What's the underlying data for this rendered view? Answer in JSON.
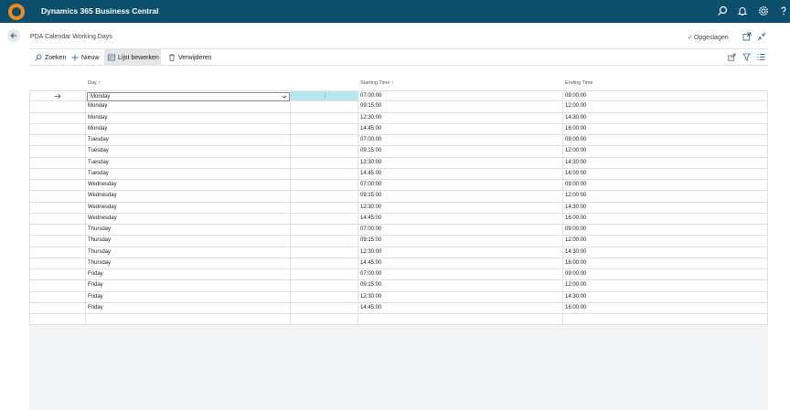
{
  "app": {
    "title": "Dynamics 365 Business Central",
    "icons": [
      "search-icon",
      "bell-icon",
      "gear-icon",
      "help-icon"
    ]
  },
  "page": {
    "title": "PDA Calendar Working Days",
    "saved_label": "Opgeslagen"
  },
  "actions": {
    "search": "Zoeken",
    "new": "Nieuw",
    "edit_list": "Lijst bewerken",
    "delete": "Verwijderen"
  },
  "grid": {
    "columns": {
      "day": "Day",
      "starting_time": "Starting Time",
      "ending_time": "Ending Time"
    },
    "sort_indicator": "↑",
    "rows": [
      {
        "day": "Monday",
        "start": "07:00:00",
        "end": "09:00:00"
      },
      {
        "day": "Monday",
        "start": "09:15:00",
        "end": "12:00:00"
      },
      {
        "day": "Monday",
        "start": "12:30:00",
        "end": "14:30:00"
      },
      {
        "day": "Monday",
        "start": "14:45:00",
        "end": "16:00:00"
      },
      {
        "day": "Tuesday",
        "start": "07:00:00",
        "end": "09:00:00"
      },
      {
        "day": "Tuesday",
        "start": "09:15:00",
        "end": "12:00:00"
      },
      {
        "day": "Tuesday",
        "start": "12:30:00",
        "end": "14:30:00"
      },
      {
        "day": "Tuesday",
        "start": "14:45:00",
        "end": "16:00:00"
      },
      {
        "day": "Wednesday",
        "start": "07:00:00",
        "end": "09:00:00"
      },
      {
        "day": "Wednesday",
        "start": "09:15:00",
        "end": "12:00:00"
      },
      {
        "day": "Wednesday",
        "start": "12:30:00",
        "end": "14:30:00"
      },
      {
        "day": "Wednesday",
        "start": "14:45:00",
        "end": "16:00:00"
      },
      {
        "day": "Thursday",
        "start": "07:00:00",
        "end": "09:00:00"
      },
      {
        "day": "Thursday",
        "start": "09:15:00",
        "end": "12:00:00"
      },
      {
        "day": "Thursday",
        "start": "12:30:00",
        "end": "14:30:00"
      },
      {
        "day": "Thursday",
        "start": "14:45:00",
        "end": "16:00:00"
      },
      {
        "day": "Friday",
        "start": "07:00:00",
        "end": "09:00:00"
      },
      {
        "day": "Friday",
        "start": "09:15:00",
        "end": "12:00:00"
      },
      {
        "day": "Friday",
        "start": "12:30:00",
        "end": "14:30:00"
      },
      {
        "day": "Friday",
        "start": "14:45:00",
        "end": "16:00:00"
      },
      {
        "day": "",
        "start": "",
        "end": ""
      }
    ]
  },
  "colors": {
    "topbar": "#0b4f6c",
    "logo": "#f08a1c",
    "selected_cell": "#b7e6ee"
  }
}
